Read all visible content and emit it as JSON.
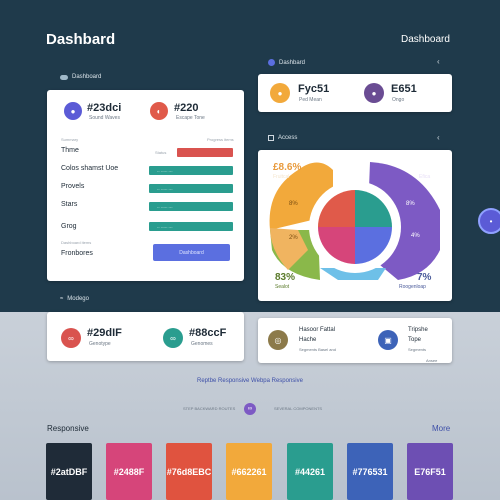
{
  "header": {
    "title": "Dashbard",
    "right_title": "Dashboard"
  },
  "left_panel": {
    "section_label": "Dashboard",
    "stat1": {
      "value": "#23dci",
      "sub": "Sound Waves",
      "color": "#5b5bd6",
      "icon": "globe-icon"
    },
    "stat2": {
      "value": "#220",
      "sub": "Escape Tone",
      "color": "#e05a4a",
      "icon": "gauge-icon"
    },
    "small_header_left": "Summary",
    "small_header_mid": "Status",
    "small_header_right": "Progress items",
    "rows": [
      {
        "label": "Thme",
        "color": "#d9534f",
        "text": "",
        "progress": 0.6
      },
      {
        "label": "Colos shamst Uoe",
        "color": "#2a9d8f",
        "text": "-- ----- ---",
        "progress": 0.88
      },
      {
        "label": "Provels",
        "color": "#2a9d8f",
        "text": "-- ----- ---",
        "progress": 0.88
      },
      {
        "label": "Stars",
        "color": "#2a9d8f",
        "text": "-- ----- ---",
        "progress": 0.88
      },
      {
        "label": "Grog",
        "color": "#2a9d8f",
        "text": "-- ----- ---",
        "progress": 0.88
      }
    ],
    "footer_small": "Dashboard items",
    "footer_label": "Fronbores",
    "button_label": "Dashboard"
  },
  "left_bottom": {
    "section_label": "Modego",
    "stat1": {
      "value": "#29dIF",
      "sub": "Genotype",
      "color": "#d9534f",
      "icon": "links-icon"
    },
    "stat2": {
      "value": "#88ccF",
      "sub": "Genomes",
      "color": "#2a9d8f",
      "icon": "links-icon"
    }
  },
  "right_top": {
    "section_label": "Dashbard",
    "stat1": {
      "value": "Fyc51",
      "sub": "Ped Mean",
      "color": "#f2a93b",
      "icon": "dot-icon"
    },
    "stat2": {
      "value": "E651",
      "sub": "Ongo",
      "color": "#6a4c93",
      "icon": "dot-icon"
    }
  },
  "right_chart": {
    "section_label": "Access",
    "label_tl": "£8.6%",
    "label_tl_sub": "Fruitcal",
    "label_tr": "68%",
    "label_tr_sub": "Efica",
    "label_bl": "83%",
    "label_bl_sub": "Sealot",
    "label_br": "7%",
    "label_br_sub": "Roogenloap",
    "inner_left": "8%",
    "inner_right": "8%",
    "inner_bl": "2%",
    "inner_br": "4%"
  },
  "right_bottom": {
    "item1_title": "Hasoor Fattal",
    "item1_line": "Hache",
    "item1_sub": "Segments Basel and",
    "item2_title": "Tripshe",
    "item2_line": "Tope",
    "item2_sub": "Segments",
    "item2_badge": "Ansee"
  },
  "middle": {
    "link_text": "Reptbe Responsive Webpa Responsive",
    "left_small": "STEP BACKWARD ROUTES",
    "right_small": "SEVERAL COMPONENTS"
  },
  "palette": {
    "title": "Responsive",
    "more": "More",
    "swatches": [
      {
        "label": "#2atDBF",
        "color": "#1f2b38"
      },
      {
        "label": "#2488F",
        "color": "#d6457a"
      },
      {
        "label": "#76d8EBC",
        "color": "#e0533f"
      },
      {
        "label": "#662261",
        "color": "#f2a93b"
      },
      {
        "label": "#44261",
        "color": "#2a9d8f"
      },
      {
        "label": "#776531",
        "color": "#3d63b8"
      },
      {
        "label": "E76F51",
        "color": "#6d4fb3"
      }
    ]
  },
  "fab": {
    "icon": "options-icon",
    "color": "#5b5bd6"
  }
}
